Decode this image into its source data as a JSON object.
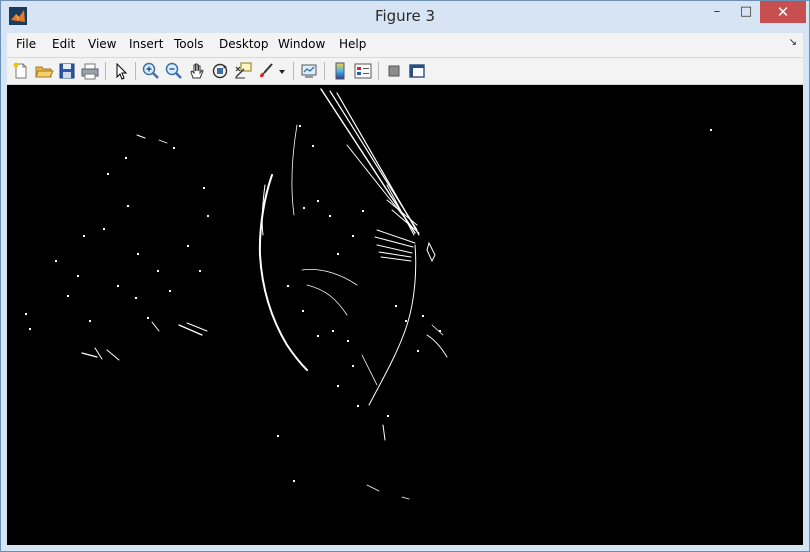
{
  "window": {
    "title": "Figure 3"
  },
  "window_controls": {
    "minimize": "–",
    "maximize": "□",
    "close": "✕"
  },
  "menu": {
    "items": [
      {
        "label": "File"
      },
      {
        "label": "Edit"
      },
      {
        "label": "View"
      },
      {
        "label": "Insert"
      },
      {
        "label": "Tools"
      },
      {
        "label": "Desktop"
      },
      {
        "label": "Window"
      },
      {
        "label": "Help"
      }
    ],
    "overflow_icon": "dock-arrow-icon"
  },
  "toolbar": {
    "icons": [
      "new-figure-icon",
      "open-file-icon",
      "save-figure-icon",
      "print-figure-icon",
      "edit-plot-arrow-icon",
      "zoom-in-icon",
      "zoom-out-icon",
      "pan-hand-icon",
      "rotate-3d-icon",
      "data-cursor-icon",
      "brush-icon",
      "brush-dropdown-icon",
      "link-plot-icon",
      "insert-colorbar-icon",
      "insert-legend-icon",
      "hide-plot-tools-icon",
      "show-plot-tools-icon"
    ]
  },
  "figure": {
    "background": "#000000",
    "stroke": "#ffffff",
    "content": "edge-map"
  }
}
